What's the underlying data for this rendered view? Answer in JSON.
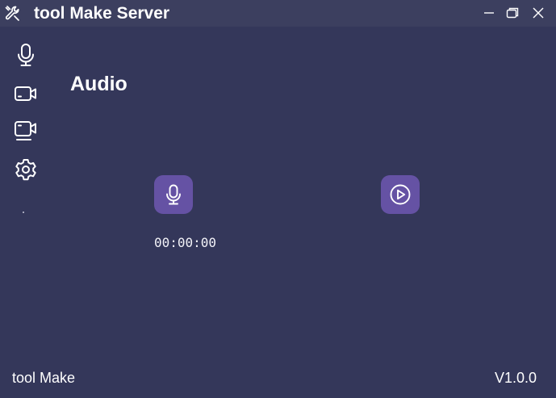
{
  "window": {
    "title": "tool Make Server",
    "app_icon": "wrench-tools-icon",
    "controls": [
      "minimize-icon",
      "restore-icon",
      "close-icon"
    ]
  },
  "sidebar": {
    "items": [
      {
        "icon": "microphone-icon"
      },
      {
        "icon": "video-camera-icon"
      },
      {
        "icon": "screen-record-icon"
      },
      {
        "icon": "gear-icon"
      }
    ],
    "extra": "."
  },
  "main": {
    "title": "Audio",
    "record_button_icon": "microphone-icon",
    "play_button_icon": "play-circle-icon",
    "timer": "00:00:00"
  },
  "footer": {
    "app_name": "tool Make",
    "version": "V1.0.0"
  },
  "colors": {
    "background": "#34375a",
    "titlebar": "#3c3f5f",
    "accent": "#6552a4",
    "text": "#ffffff"
  }
}
